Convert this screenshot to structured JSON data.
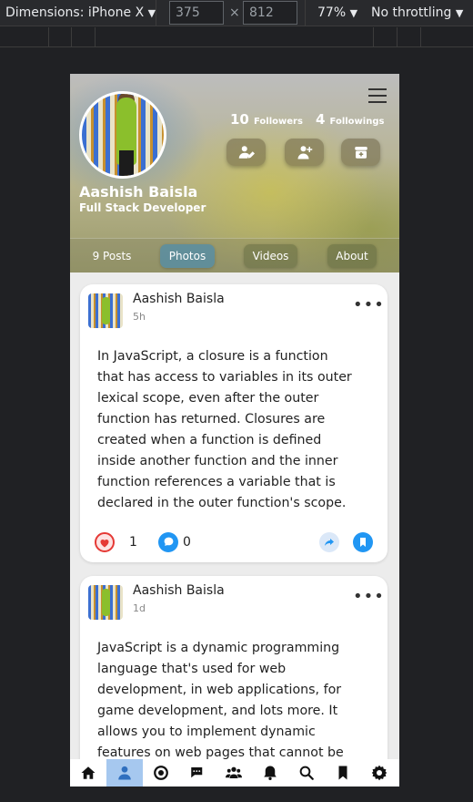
{
  "devtools": {
    "device": "Dimensions: iPhone X",
    "width": "375",
    "times": "×",
    "height": "812",
    "zoom": "77%",
    "throttle": "No throttling",
    "caret": "▼"
  },
  "profile": {
    "name": "Aashish Baisla",
    "role": "Full Stack Developer",
    "followers_count": "10",
    "followers_label": "Followers",
    "followings_count": "4",
    "followings_label": "Followings"
  },
  "tabs": [
    {
      "label": "9 Posts"
    },
    {
      "label": "Photos"
    },
    {
      "label": "Videos"
    },
    {
      "label": "About"
    }
  ],
  "posts": [
    {
      "author": "Aashish Baisla",
      "time": "5h",
      "lines": [
        "In JavaScript, a closure is a function",
        "that has access to variables in its outer",
        "lexical scope, even after the outer",
        "function has returned. Closures are",
        "created when a function is defined",
        "inside another function and the inner",
        "function references a variable that is",
        "declared in the outer function's scope."
      ],
      "likes": "1",
      "comments": "0"
    },
    {
      "author": "Aashish Baisla",
      "time": "1d",
      "lines": [
        "JavaScript is a dynamic programming",
        "language that's used for web",
        "development, in web applications, for",
        "game development, and lots more. It",
        "allows you to implement dynamic",
        "features on web pages that cannot be"
      ]
    }
  ],
  "colors": {
    "accent": "#2196f3",
    "like": "#e53935",
    "active_nav": "#a6c8ef"
  },
  "bottom_nav": [
    "home-icon",
    "user-icon",
    "explore-icon",
    "chat-icon",
    "group-icon",
    "bell-icon",
    "search-icon",
    "bookmark-icon",
    "settings-icon"
  ]
}
